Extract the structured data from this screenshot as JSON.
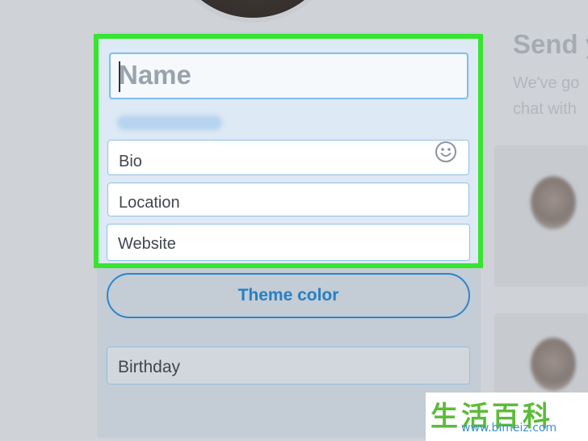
{
  "profile": {
    "name_placeholder": "Name",
    "bio_placeholder": "Bio",
    "location_placeholder": "Location",
    "website_placeholder": "Website",
    "theme_color_label": "Theme color",
    "birthday_label": "Birthday"
  },
  "right_panel": {
    "title": "Send y",
    "line1": "We've go",
    "line2": "chat with"
  },
  "watermark": {
    "chars": "生活百科",
    "url": "www.bimeiz.com"
  },
  "colors": {
    "highlight": "#37e52f",
    "accent": "#2480c4"
  },
  "icons": {
    "emoji": "smiley-icon"
  }
}
